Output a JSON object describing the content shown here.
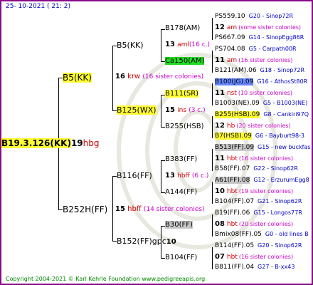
{
  "header": "25- 10-2021 ( 21:  2)",
  "footer": "Copyright 2004-2021 © Karl Kehrle Foundation   www.pedigreeapis.org",
  "root": {
    "id": "B19.3.126(KK)",
    "num": "19",
    "code": "hbg"
  },
  "g1": {
    "top": {
      "id": "B5(KK)",
      "num": "16",
      "code": "krw",
      "note": "(16 sister colonies)"
    },
    "bottom": {
      "id": "B252H(FF)",
      "num": "15",
      "code": "hbff",
      "note": "(14 sister colonies)"
    }
  },
  "g2": [
    {
      "id": "B5(KK)"
    },
    {
      "id": "B125(WX)",
      "num": "15",
      "code": "ins",
      "note": "(3 c.)"
    },
    {
      "id": "B116(FF)",
      "num": "13",
      "code": "hbff",
      "note": "(6 c.)"
    },
    {
      "id": "B152(FF)gpc",
      "num": "10"
    }
  ],
  "g3": [
    {
      "id": "B178(AM)",
      "num": "13",
      "code": "aml",
      "note": "(16 c.)"
    },
    {
      "id": "Ca150(AM)"
    },
    {
      "id": "B111(SR)"
    },
    {
      "id": "B255(HSB)"
    },
    {
      "id": "B383(FF)"
    },
    {
      "id": "A144(FF)"
    },
    {
      "id": "B30(FF)"
    },
    {
      "id": "B104(FF)"
    }
  ],
  "g4": [
    {
      "id": "PS559.10",
      "tag": "G20 - Sinop72R"
    },
    {
      "num": "12",
      "code": "am",
      "note": "(some sister colonies)"
    },
    {
      "id": "PS667.09",
      "tag": "G14 - SinopEgg86R"
    },
    {
      "id": "PS704.08",
      "tag": "G5 - Carpath00R"
    },
    {
      "num": "11",
      "code": "am",
      "note": "(16 sister colonies)"
    },
    {
      "id": "B121(AM).06",
      "tag": "G18 - Sinop72R"
    },
    {
      "id": "B100(JG).09",
      "tag": "G16 - AthosSt80R"
    },
    {
      "num": "11",
      "code": "nst",
      "note": "(10 sister colonies)"
    },
    {
      "id": "B1003(NE).09",
      "tag": "G5 - B1003(NE)"
    },
    {
      "id": "B255(HSB).09",
      "tag": "G8 - Cankiri97Q"
    },
    {
      "num": "12",
      "code": "hb",
      "note": "(20 sister colonies)"
    },
    {
      "id": "B7(HSB).09",
      "tag": "G6 - Bayburt98-3"
    },
    {
      "id": "B513(FF).09",
      "tag": "G15 - new buckfas"
    },
    {
      "num": "11",
      "code": "hbt",
      "note": "(16 sister colonies)"
    },
    {
      "id": "B58(FF).07",
      "tag": "G22 - Sinop62R"
    },
    {
      "id": "A61(FF).08",
      "tag": "G12 - ErzurumEgg8"
    },
    {
      "num": "10",
      "code": "hbt",
      "note": "(19 sister colonies)"
    },
    {
      "id": "B104(FF).07",
      "tag": "G21 - Sinop62R"
    },
    {
      "id": "B19(FF).06",
      "tag": "G15 - Longos77R"
    },
    {
      "num": "08",
      "code": "hbt",
      "note": "(20 sister colonies)"
    },
    {
      "id": "Bmix08(FF).05",
      "tag": "G0 - old lines B"
    },
    {
      "id": "B114(FF).05",
      "tag": "G20 - Sinop62R"
    },
    {
      "num": "07",
      "code": "hbt",
      "note": "(16 sister colonies)"
    },
    {
      "id": "B811(FF).04",
      "tag": "G27 - B-xx43"
    }
  ],
  "colors": {
    "frame": "#8a0a8a",
    "yellow": "#ffff33",
    "green": "#22dd22",
    "blue": "#6688ff",
    "gray": "#c8c8c8",
    "tag": "#0000cc",
    "code": "#cc0000",
    "note": "#cc00cc",
    "footer": "#008800"
  }
}
